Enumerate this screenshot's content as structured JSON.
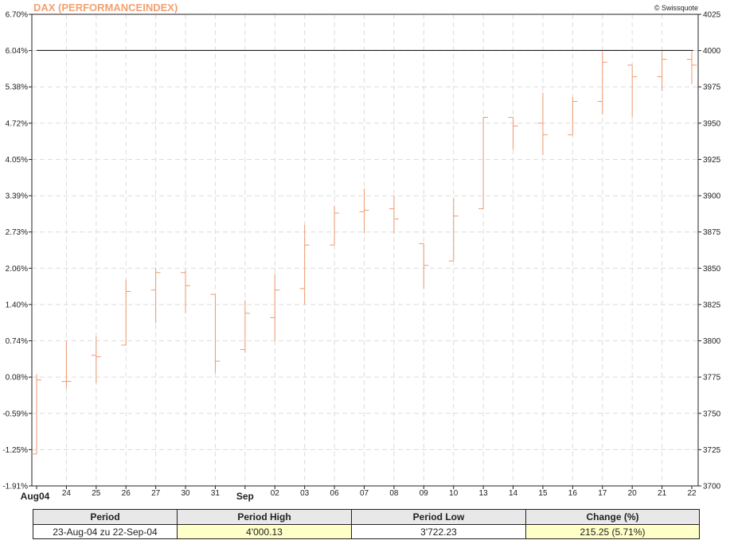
{
  "header": {
    "title": "DAX (PERFORMANCEINDEX)",
    "brand": "© Swissquote"
  },
  "chart_data": {
    "type": "ohlc",
    "title": "DAX (PERFORMANCEINDEX)",
    "y_left_ticks": [
      "6.70%",
      "6.04%",
      "5.38%",
      "4.72%",
      "4.05%",
      "3.39%",
      "2.73%",
      "2.06%",
      "1.40%",
      "0.74%",
      "0.08%",
      "-0.59%",
      "-1.25%",
      "-1.91%"
    ],
    "y_right_ticks": [
      4025,
      4000,
      3975,
      3950,
      3925,
      3900,
      3875,
      3850,
      3825,
      3800,
      3775,
      3750,
      3725,
      3700
    ],
    "ylim": [
      3700,
      4025
    ],
    "reference_line": 4000.13,
    "grid": true,
    "x_labels": [
      "Aug04",
      "24",
      "25",
      "26",
      "27",
      "30",
      "31",
      "Sep",
      "02",
      "03",
      "06",
      "07",
      "08",
      "09",
      "10",
      "13",
      "14",
      "15",
      "16",
      "17",
      "20",
      "21",
      "22"
    ],
    "bars": [
      {
        "open": 3722,
        "high": 3777,
        "low": 3722,
        "close": 3773
      },
      {
        "open": 3772,
        "high": 3800,
        "low": 3767,
        "close": 3772
      },
      {
        "open": 3790,
        "high": 3803,
        "low": 3771,
        "close": 3789
      },
      {
        "open": 3797,
        "high": 3842,
        "low": 3797,
        "close": 3834
      },
      {
        "open": 3835,
        "high": 3850,
        "low": 3812,
        "close": 3847
      },
      {
        "open": 3847,
        "high": 3849,
        "low": 3819,
        "close": 3838
      },
      {
        "open": 3832,
        "high": 3832,
        "low": 3778,
        "close": 3786
      },
      {
        "open": 3794,
        "high": 3828,
        "low": 3792,
        "close": 3819
      },
      {
        "open": 3816,
        "high": 3846,
        "low": 3800,
        "close": 3835
      },
      {
        "open": 3836,
        "high": 3880,
        "low": 3825,
        "close": 3866
      },
      {
        "open": 3866,
        "high": 3893,
        "low": 3866,
        "close": 3888
      },
      {
        "open": 3889,
        "high": 3905,
        "low": 3874,
        "close": 3890
      },
      {
        "open": 3891,
        "high": 3900,
        "low": 3874,
        "close": 3884
      },
      {
        "open": 3867,
        "high": 3867,
        "low": 3836,
        "close": 3852
      },
      {
        "open": 3855,
        "high": 3898,
        "low": 3855,
        "close": 3886
      },
      {
        "open": 3891,
        "high": 3954,
        "low": 3891,
        "close": 3954
      },
      {
        "open": 3954,
        "high": 3954,
        "low": 3932,
        "close": 3948
      },
      {
        "open": 3950,
        "high": 3971,
        "low": 3928,
        "close": 3942
      },
      {
        "open": 3942,
        "high": 3968,
        "low": 3942,
        "close": 3965
      },
      {
        "open": 3965,
        "high": 4000,
        "low": 3956,
        "close": 3992
      },
      {
        "open": 3990,
        "high": 3990,
        "low": 3954,
        "close": 3982
      },
      {
        "open": 3982,
        "high": 4000,
        "low": 3972,
        "close": 3994
      },
      {
        "open": 3994,
        "high": 4000,
        "low": 3977,
        "close": 3990
      }
    ]
  },
  "summary": {
    "headers": [
      "Period",
      "Period High",
      "Period Low",
      "Change (%)"
    ],
    "values": [
      "23-Aug-04 zu 22-Sep-04",
      "4'000.13",
      "3'722.23",
      "215.25 (5.71%)"
    ]
  }
}
